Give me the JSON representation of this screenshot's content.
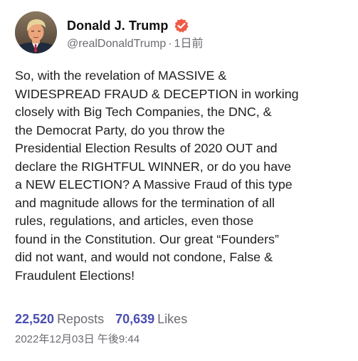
{
  "author": {
    "display_name": "Donald J. Trump",
    "handle": "@realDonaldTrump",
    "separator": "·",
    "relative_time": "1日前",
    "verified": true,
    "avatar_icon": "profile-photo",
    "verified_icon": "verified-badge-icon"
  },
  "post": {
    "text": "So, with the revelation of MASSIVE &\nWIDESPREAD FRAUD & DECEPTION in working\nclosely with Big Tech Companies, the DNC, &\nthe Democrat Party, do you throw the\nPresidential Election Results of 2020 OUT and\ndeclare the RIGHTFUL WINNER, or do you have\na NEW ELECTION? A Massive Fraud of this type\nand magnitude allows for the termination of all\nrules, regulations, and articles, even those\nfound in the Constitution. Our great “Founders”\ndid not want, and would not condone, False &\nFraudulent Elections!"
  },
  "stats": {
    "reposts_count": "22,520",
    "reposts_label": "Reposts",
    "likes_count": "70,639",
    "likes_label": "Likes"
  },
  "timestamp": "2022年12月03日 午後9:44",
  "colors": {
    "accent": "#4a4eb0",
    "badge": "#f05a45",
    "secondary_text": "#6b6b72",
    "body_text": "#1f1f1f"
  }
}
